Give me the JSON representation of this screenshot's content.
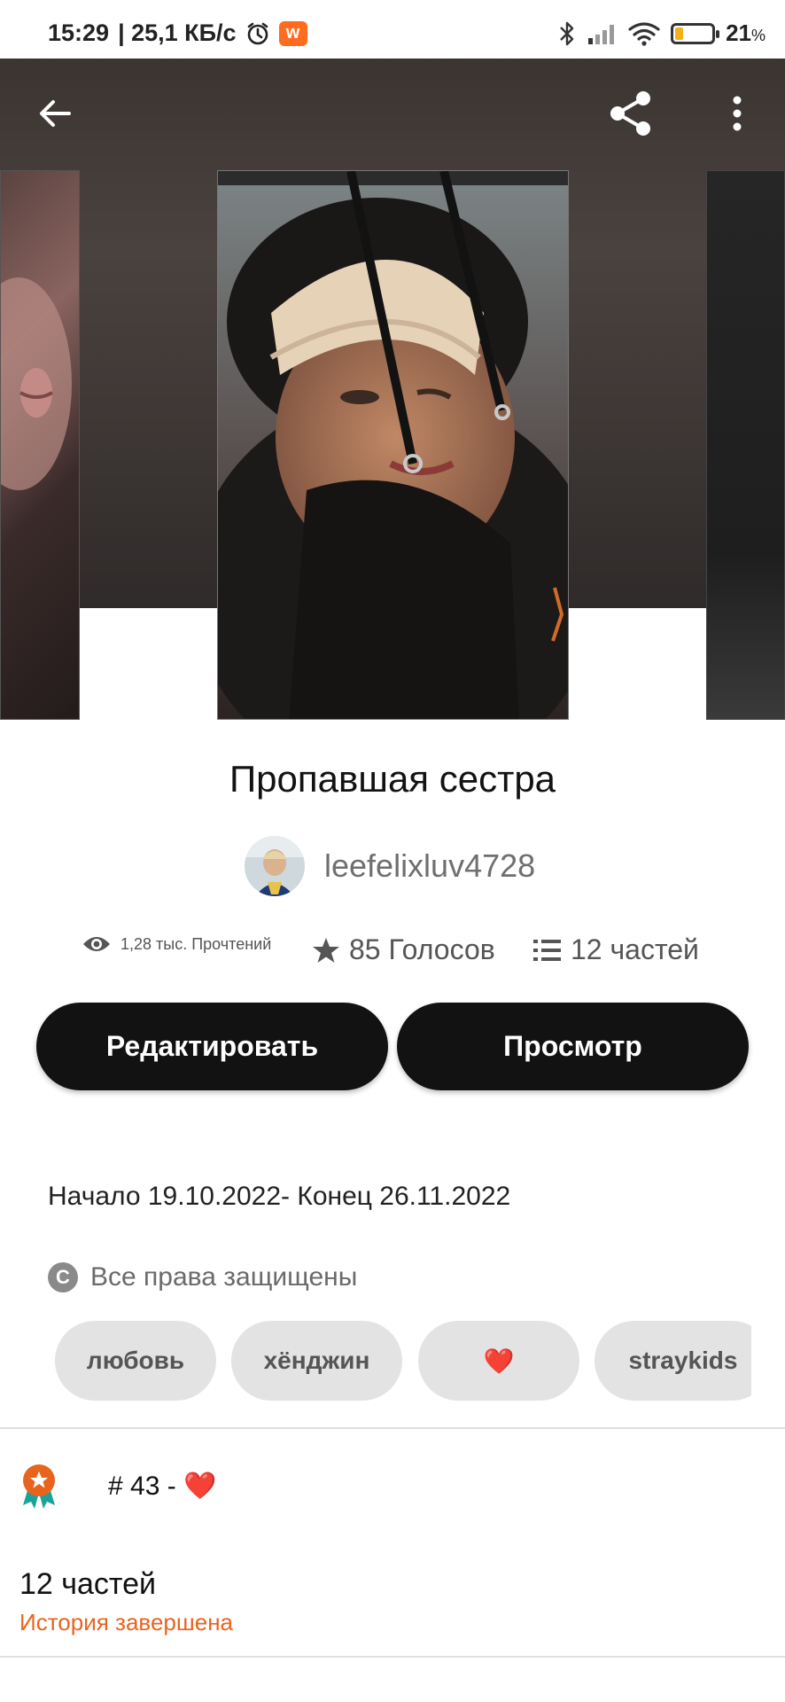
{
  "status_bar": {
    "time": "15:29",
    "speed": "| 25,1 КБ/с",
    "app_badge": "w",
    "battery": "21",
    "battery_unit": "%",
    "battery_level": 0.21
  },
  "header": {
    "back_icon": "arrow-left-icon",
    "share_icon": "share-icon",
    "more_icon": "more-vertical-icon"
  },
  "story": {
    "title": "Пропавшая сестра",
    "author": "leefelixluv4728",
    "reads": "1,28 тыс. Прочтений",
    "votes": "85 Голосов",
    "parts": "12 частей"
  },
  "actions": {
    "edit_label": "Редактировать",
    "view_label": "Просмотр"
  },
  "description": {
    "dates": "Начало 19.10.2022- Конец 26.11.2022",
    "copyright": "Все права защищены"
  },
  "tags": [
    "любовь",
    "хёнджин",
    "❤️",
    "straykids"
  ],
  "ranking": {
    "text": "# 43 - ❤️"
  },
  "parts_section": {
    "title": "12 частей",
    "status": "История завершена"
  },
  "colors": {
    "accent": "#e8641e",
    "button": "#121212",
    "tag_bg": "#e3e3e3"
  }
}
